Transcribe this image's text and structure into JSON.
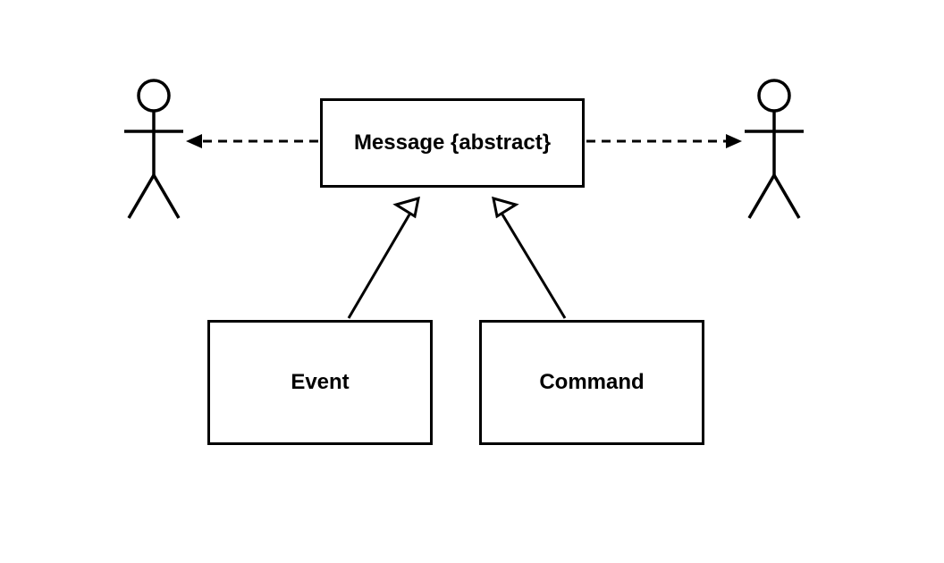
{
  "diagram": {
    "type": "uml-class-inheritance",
    "abstractClass": {
      "label": "Message {abstract}"
    },
    "subclasses": [
      {
        "label": "Event"
      },
      {
        "label": "Command"
      }
    ],
    "actors": {
      "left": "actor",
      "right": "actor"
    },
    "relations": {
      "leftActor": "dependency-dashed-arrow",
      "rightActor": "dependency-dashed-arrow",
      "eventToMessage": "generalization-open-triangle",
      "commandToMessage": "generalization-open-triangle"
    }
  }
}
